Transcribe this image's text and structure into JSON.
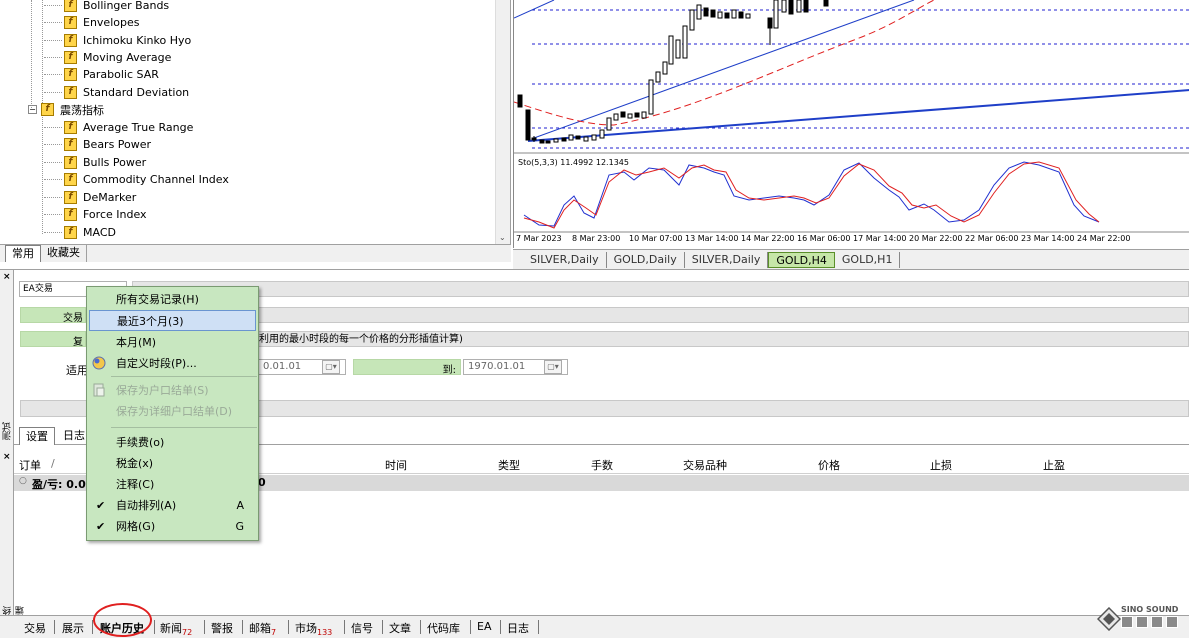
{
  "navigator": {
    "indicators_top": [
      "Bollinger Bands",
      "Envelopes",
      "Ichimoku Kinko Hyo",
      "Moving Average",
      "Parabolic SAR",
      "Standard Deviation"
    ],
    "oscillators_folder": "震荡指标",
    "oscillators": [
      "Average True Range",
      "Bears Power",
      "Bulls Power",
      "Commodity Channel Index",
      "DeMarker",
      "Force Index",
      "MACD"
    ],
    "tabs": [
      "常用",
      "收藏夹"
    ]
  },
  "chart": {
    "indicator_label": "Sto(5,3,3) 11.4992 12.1345",
    "time_labels": [
      "7 Mar 2023",
      "8 Mar 23:00",
      "10 Mar 07:00",
      "13 Mar 14:00",
      "14 Mar 22:00",
      "16 Mar 06:00",
      "17 Mar 14:00",
      "20 Mar 22:00",
      "22 Mar 06:00",
      "23 Mar 14:00",
      "24 Mar 22:00"
    ],
    "tabs": [
      "SILVER,Daily",
      "GOLD,Daily",
      "SILVER,Daily",
      "GOLD,H4",
      "GOLD,H1"
    ],
    "active_tab": "GOLD,H4",
    "colors": {
      "up_trend": "#1f3fc8",
      "ma": "#e02020",
      "stoch_main": "#2030d0",
      "stoch_signal": "#e02020",
      "grid": "#2020d0"
    }
  },
  "tester": {
    "ea_label": "EA交易",
    "field1_label": "交易",
    "field2_label": "复",
    "field2_note": "利用的最小时段的每一个价格的分形插值计算)",
    "date_label": "适用",
    "date_from": "0.01.01",
    "to_label": "到:",
    "date_to": "1970.01.01",
    "side_label": "测试",
    "tabs": [
      "设置",
      "日志"
    ]
  },
  "history": {
    "columns": [
      "订单",
      "/",
      "时间",
      "类型",
      "手数",
      "交易品种",
      "价格",
      "止损",
      "止盈"
    ],
    "summary": "盈/亏: 0.00",
    "summary_tail": "0",
    "side_label": "终端"
  },
  "context_menu": {
    "items": [
      {
        "label": "所有交易记录(H)",
        "shortcut": "",
        "state": "normal"
      },
      {
        "label": "最近3个月(3)",
        "shortcut": "",
        "state": "highlighted"
      },
      {
        "label": "本月(M)",
        "shortcut": "",
        "state": "normal"
      },
      {
        "label": "自定义时段(P)...",
        "shortcut": "",
        "state": "normal",
        "icon": "calendar-icon"
      },
      {
        "label": "保存为户口结单(S)",
        "shortcut": "",
        "state": "disabled",
        "icon": "save-report-icon"
      },
      {
        "label": "保存为详细户口结单(D)",
        "shortcut": "",
        "state": "disabled"
      },
      {
        "label": "手续费(o)",
        "shortcut": "",
        "state": "normal"
      },
      {
        "label": "税金(x)",
        "shortcut": "",
        "state": "normal"
      },
      {
        "label": "注释(C)",
        "shortcut": "",
        "state": "normal"
      },
      {
        "label": "自动排列(A)",
        "shortcut": "A",
        "state": "checked"
      },
      {
        "label": "网格(G)",
        "shortcut": "G",
        "state": "checked"
      }
    ]
  },
  "bottom_tabs": [
    {
      "label": "交易",
      "count": ""
    },
    {
      "label": "展示",
      "count": ""
    },
    {
      "label": "账户历史",
      "count": ""
    },
    {
      "label": "新闻",
      "count": "72"
    },
    {
      "label": "警报",
      "count": ""
    },
    {
      "label": "邮箱",
      "count": "7"
    },
    {
      "label": "市场",
      "count": "133"
    },
    {
      "label": "信号",
      "count": ""
    },
    {
      "label": "文章",
      "count": ""
    },
    {
      "label": "代码库",
      "count": ""
    },
    {
      "label": "EA",
      "count": ""
    },
    {
      "label": "日志",
      "count": ""
    }
  ],
  "watermark": {
    "line1": "SINO SOUND"
  }
}
